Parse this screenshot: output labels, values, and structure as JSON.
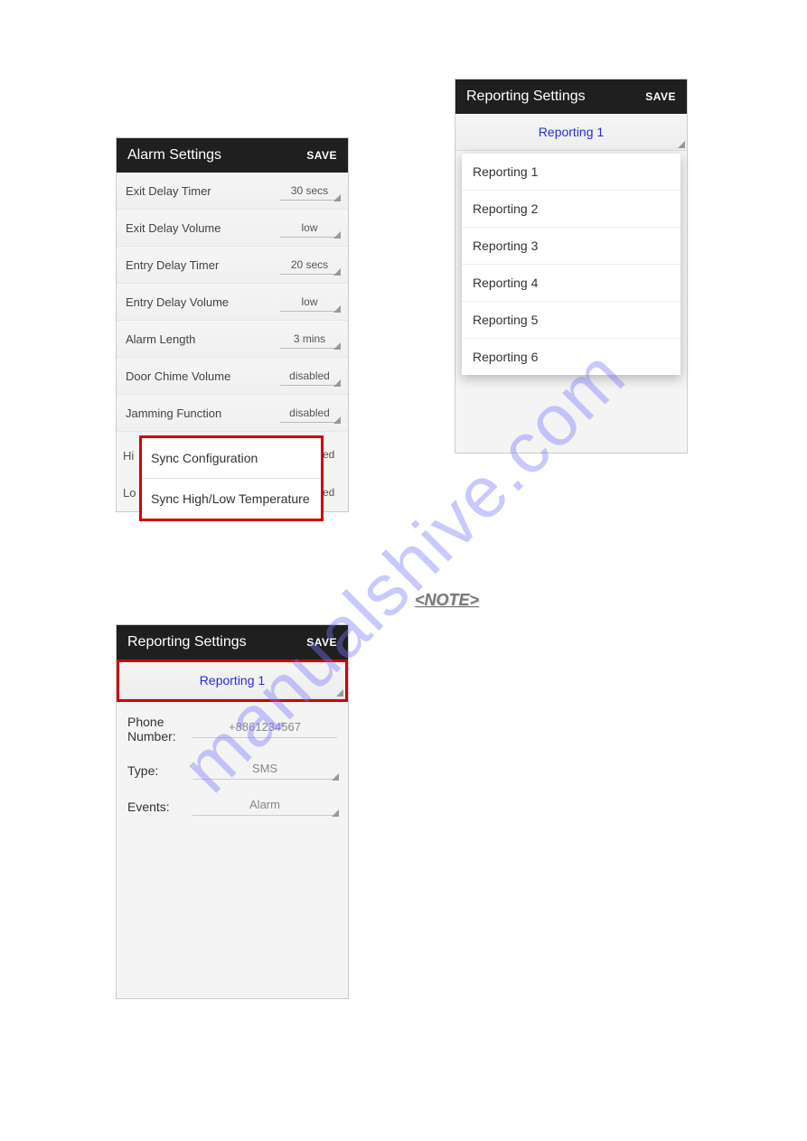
{
  "watermark": "manualshive.com",
  "note_label": "<NOTE>",
  "phone1": {
    "title": "Alarm Settings",
    "save": "SAVE",
    "rows": [
      {
        "label": "Exit Delay Timer",
        "value": "30 secs"
      },
      {
        "label": "Exit Delay Volume",
        "value": "low"
      },
      {
        "label": "Entry Delay Timer",
        "value": "20 secs"
      },
      {
        "label": "Entry Delay Volume",
        "value": "low"
      },
      {
        "label": "Alarm Length",
        "value": "3 mins"
      },
      {
        "label": "Door Chime Volume",
        "value": "disabled"
      },
      {
        "label": "Jamming Function",
        "value": "disabled"
      }
    ],
    "partial_hi_prefix": "Hi",
    "partial_lo_prefix": "Lo",
    "partial_suffix": "ed",
    "sync_popup": [
      "Sync Configuration",
      "Sync High/Low Temperature"
    ]
  },
  "phone2": {
    "title": "Reporting Settings",
    "save": "SAVE",
    "tab_label": "Reporting 1",
    "dropdown": [
      "Reporting 1",
      "Reporting 2",
      "Reporting 3",
      "Reporting 4",
      "Reporting 5",
      "Reporting 6"
    ]
  },
  "phone3": {
    "title": "Reporting Settings",
    "save": "SAVE",
    "tab_label": "Reporting 1",
    "rows": [
      {
        "label": "Phone Number:",
        "value": "+8861234567"
      },
      {
        "label": "Type:",
        "value": "SMS"
      },
      {
        "label": "Events:",
        "value": "Alarm"
      }
    ]
  }
}
